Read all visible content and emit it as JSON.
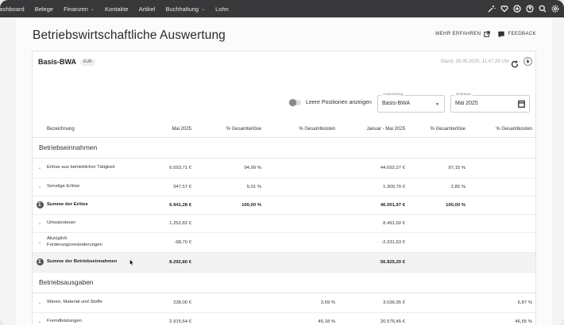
{
  "nav": {
    "items": [
      {
        "label": "Dashboard",
        "caret": false
      },
      {
        "label": "Belege",
        "caret": false
      },
      {
        "label": "Finanzen",
        "caret": true
      },
      {
        "label": "Kontakte",
        "caret": false
      },
      {
        "label": "Artikel",
        "caret": false
      },
      {
        "label": "Buchhaltung",
        "caret": true
      },
      {
        "label": "Lohn",
        "caret": false
      }
    ],
    "icons": [
      "magic-wand-icon",
      "heart-icon",
      "plus-circle-icon",
      "help-icon",
      "search-icon",
      "settings-icon"
    ]
  },
  "header": {
    "title": "Betriebswirtschaftliche Auswertung",
    "learn_more": "MEHR ERFAHREN",
    "feedback": "FEEDBACK"
  },
  "card": {
    "title": "Basis-BWA",
    "currency": "EUR",
    "stand": "Stand: 28.05.2025, 11:47:29 Uhr",
    "toggle_label": "Leere Positionen anzeigen",
    "auswertung_label": "Auswertung",
    "auswertung_value": "Basis-BWA",
    "zeitraum_label": "Zeitraum",
    "zeitraum_value": "Mai 2025"
  },
  "table": {
    "headers": [
      "Bezeichnung",
      "Mai 2025",
      "% Gesamterlöse",
      "% Gesamtkosten",
      "Januar - Mai 2025",
      "% Gesamterlöse",
      "% Gesamtkosten"
    ],
    "sections": [
      {
        "title": "Betriebseinnahmen",
        "rows": [
          {
            "kind": "item",
            "label": "Erlöse aus betrieblicher Tätigkeit",
            "v": [
              "6.593,71 €",
              "94,99 %",
              "",
              "44.692,27 €",
              "97,15 %",
              ""
            ]
          },
          {
            "kind": "item",
            "label": "Sonstige Erlöse",
            "v": [
              "347,57 €",
              "5,01 %",
              "",
              "1.309,70 €",
              "2,85 %",
              ""
            ]
          },
          {
            "kind": "sum",
            "label": "Summe der Erlöse",
            "v": [
              "6.941,28 €",
              "100,00 %",
              "",
              "46.001,97 €",
              "100,00 %",
              ""
            ]
          },
          {
            "kind": "item",
            "label": "Umsatzsteuer",
            "v": [
              "1.252,82 €",
              "",
              "",
              "8.491,60 €",
              "",
              ""
            ]
          },
          {
            "kind": "item",
            "label": "Abzüglich Forderungsveränderungen",
            "v": [
              "-98,70 €",
              "",
              "",
              "-2.331,63 €",
              "",
              ""
            ]
          },
          {
            "kind": "sum-shade",
            "label": "Summe der Betriebseinnahmen",
            "v": [
              "8.292,80 €",
              "",
              "",
              "56.825,20 €",
              "",
              ""
            ]
          }
        ]
      },
      {
        "title": "Betriebsausgaben",
        "rows": [
          {
            "kind": "item",
            "label": "Waren, Material und Stoffe",
            "v": [
              "238,00 €",
              "",
              "3,69 %",
              "3.036,95 €",
              "",
              "6,87 %"
            ]
          },
          {
            "kind": "item",
            "label": "Fremdleistungen",
            "v": [
              "2.915,64 €",
              "",
              "45,18 %",
              "20.576,45 €",
              "",
              "46,55 %"
            ]
          }
        ]
      }
    ]
  }
}
